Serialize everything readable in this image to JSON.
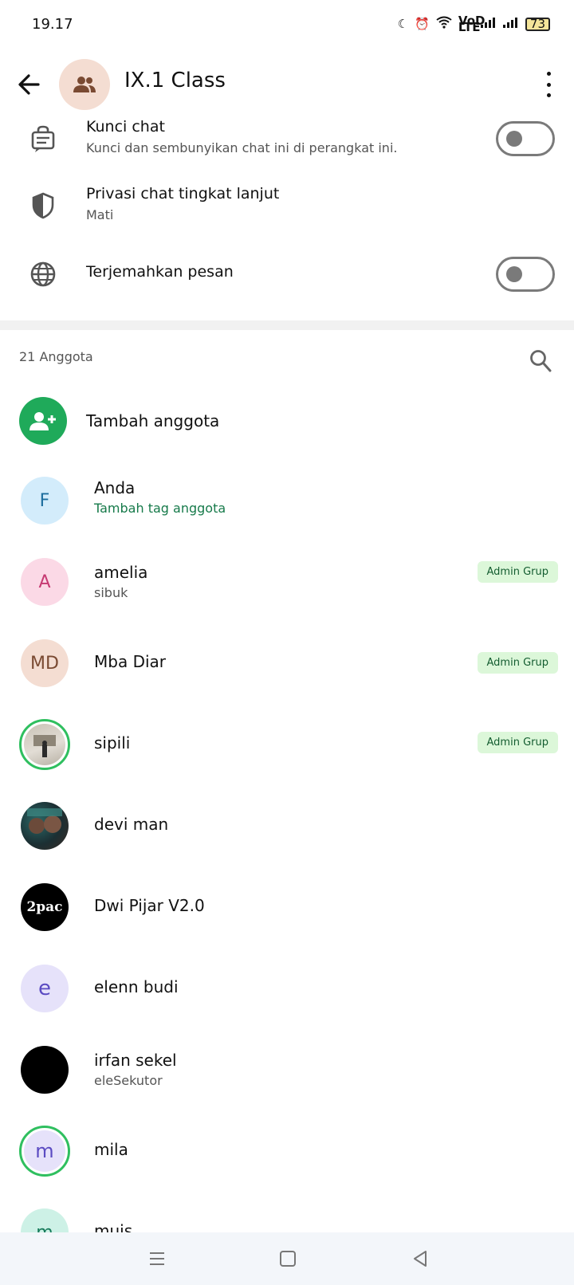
{
  "status": {
    "time": "19.17",
    "battery": "73",
    "network": "VoD LTE"
  },
  "header": {
    "title": "IX.1 Class"
  },
  "settings": {
    "lock": {
      "title": "Kunci chat",
      "subtitle": "Kunci dan sembunyikan chat ini di perangkat ini.",
      "enabled": false
    },
    "privacy": {
      "title": "Privasi chat tingkat lanjut",
      "subtitle": "Mati"
    },
    "translate": {
      "title": "Terjemahkan pesan",
      "enabled": false
    }
  },
  "members": {
    "count_label": "21 Anggota",
    "add_label": "Tambah anggota",
    "list": [
      {
        "name": "Anda",
        "subtitle": "Tambah tag anggota",
        "initial": "F",
        "badge": ""
      },
      {
        "name": "amelia",
        "subtitle": "sibuk",
        "initial": "A",
        "badge": "Admin Grup"
      },
      {
        "name": "Mba Diar",
        "subtitle": "",
        "initial": "MD",
        "badge": "Admin Grup"
      },
      {
        "name": "sipili",
        "subtitle": "",
        "initial": "",
        "badge": "Admin Grup"
      },
      {
        "name": "devi man",
        "subtitle": "",
        "initial": "",
        "badge": ""
      },
      {
        "name": "Dwi Pijar V2.0",
        "subtitle": "",
        "initial": "2pac",
        "badge": ""
      },
      {
        "name": "elenn budi",
        "subtitle": "",
        "initial": "e",
        "badge": ""
      },
      {
        "name": "irfan sekel",
        "subtitle": "eleSekutor",
        "initial": "",
        "badge": ""
      },
      {
        "name": "mila",
        "subtitle": "",
        "initial": "m",
        "badge": ""
      },
      {
        "name": "muis",
        "subtitle": "",
        "initial": "m",
        "badge": ""
      }
    ]
  },
  "colors": {
    "accent": "#1faa5a",
    "badge_bg": "#dcf7d9",
    "badge_text": "#135c30"
  }
}
